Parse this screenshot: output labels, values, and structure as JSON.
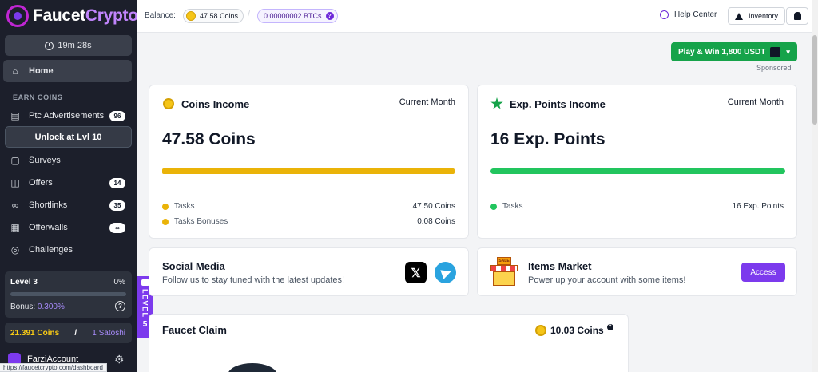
{
  "brand": {
    "part1": "Faucet",
    "part2": "Crypto"
  },
  "sidebar": {
    "timer": "19m 28s",
    "home": "Home",
    "section_label": "EARN COINS",
    "items": [
      {
        "label": "Ptc Advertisements",
        "badge": "96"
      },
      {
        "label": "Surveys"
      },
      {
        "label": "Offers",
        "badge": "14"
      },
      {
        "label": "Shortlinks",
        "badge": "35"
      },
      {
        "label": "Offerwalls",
        "badge": "∞"
      },
      {
        "label": "Challenges"
      }
    ],
    "unlock_label": "Unlock at Lvl 10",
    "level": {
      "title": "Level 3",
      "percent": "0%",
      "progress": 0,
      "bonus_label": "Bonus:",
      "bonus_value": "0.300%"
    },
    "balance": {
      "coins": "21.391 Coins",
      "separator": "/",
      "satoshi": "1 Satoshi"
    },
    "account_name": "FarziAccount"
  },
  "level_tab": {
    "text": "LEVEL",
    "number": "5"
  },
  "header": {
    "balance_label": "Balance:",
    "coins_pill": "47.58 Coins",
    "separator": "/",
    "btc_pill": "0.00000002 BTCs",
    "help": "Help Center",
    "inventory": "Inventory"
  },
  "promo": {
    "play_button": "Play & Win 1,800 USDT",
    "sponsored": "Sponsored"
  },
  "coins_income": {
    "title": "Coins Income",
    "period": "Current Month",
    "amount": "47.58 Coins",
    "progress": 1.0,
    "rows": [
      {
        "label": "Tasks",
        "value": "47.50 Coins"
      },
      {
        "label": "Tasks Bonuses",
        "value": "0.08 Coins"
      }
    ]
  },
  "exp_income": {
    "title": "Exp. Points Income",
    "period": "Current Month",
    "amount": "16 Exp. Points",
    "progress": 1.0,
    "rows": [
      {
        "label": "Tasks",
        "value": "16 Exp. Points"
      }
    ]
  },
  "social": {
    "title": "Social Media",
    "desc": "Follow us to stay tuned with the latest updates!"
  },
  "market": {
    "title": "Items Market",
    "desc": "Power up your account with some items!",
    "button": "Access",
    "sign": "SALE"
  },
  "faucet": {
    "title": "Faucet Claim",
    "amount": "10.03 Coins"
  },
  "statusbar": {
    "url": "https://faucetcrypto.com/dashboard"
  },
  "colors": {
    "accent": "#7c3aed",
    "coin": "#eab308",
    "green": "#22c55e",
    "sidebar": "#1c1f2b"
  }
}
